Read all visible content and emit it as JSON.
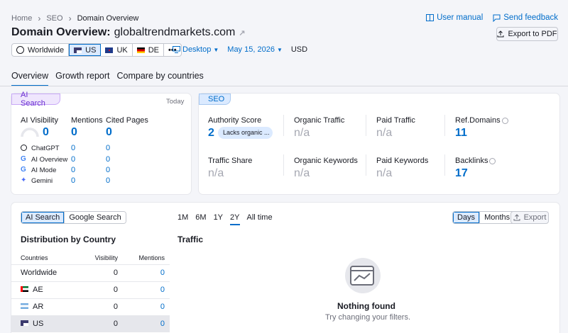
{
  "breadcrumb": [
    "Home",
    "SEO",
    "Domain Overview"
  ],
  "top_links": {
    "manual": "User manual",
    "feedback": "Send feedback"
  },
  "title": {
    "prefix": "Domain Overview:",
    "domain": "globaltrendmarkets.com"
  },
  "export_pdf": "Export to PDF",
  "databases": [
    "Worldwide",
    "US",
    "UK",
    "DE",
    "•••"
  ],
  "filters": {
    "device": "Desktop",
    "date": "May 15, 2026",
    "currency": "USD"
  },
  "tabs": [
    "Overview",
    "Growth report",
    "Compare by countries"
  ],
  "ai_card": {
    "label": "AI Search",
    "today": "Today",
    "headers": [
      "AI Visibility",
      "Mentions",
      "Cited Pages"
    ],
    "visibility": "0",
    "mentions": "0",
    "cited": "0",
    "rows": [
      {
        "name": "ChatGPT",
        "m": "0",
        "c": "0"
      },
      {
        "name": "AI Overview",
        "m": "0",
        "c": "0"
      },
      {
        "name": "AI Mode",
        "m": "0",
        "c": "0"
      },
      {
        "name": "Gemini",
        "m": "0",
        "c": "0"
      }
    ]
  },
  "seo_card": {
    "label": "SEO",
    "authority_label": "Authority Score",
    "authority_value": "2",
    "authority_badge": "Lacks organic ...",
    "organic_traffic": "Organic Traffic",
    "paid_traffic": "Paid Traffic",
    "ref_domains": "Ref.Domains",
    "ref_domains_value": "11",
    "traffic_share": "Traffic Share",
    "organic_keywords": "Organic Keywords",
    "paid_keywords": "Paid Keywords",
    "backlinks": "Backlinks",
    "backlinks_value": "17",
    "na": "n/a"
  },
  "bottom": {
    "toggle": [
      "AI Search",
      "Google Search"
    ],
    "periods": [
      "1M",
      "6M",
      "1Y",
      "2Y",
      "All time"
    ],
    "range": [
      "Days",
      "Months"
    ],
    "export": "Export",
    "dist_title": "Distribution by Country",
    "traffic_title": "Traffic",
    "table_headers": [
      "Countries",
      "Visibility",
      "Mentions"
    ],
    "rows": [
      {
        "country": "Worldwide",
        "visibility": "0",
        "mentions": "0"
      },
      {
        "country": "AE",
        "visibility": "0",
        "mentions": "0"
      },
      {
        "country": "AR",
        "visibility": "0",
        "mentions": "0"
      },
      {
        "country": "US",
        "visibility": "0",
        "mentions": "0"
      }
    ],
    "nothing_found": "Nothing found",
    "nothing_hint": "Try changing your filters."
  },
  "colors": {
    "accent": "#006dca",
    "ai_pill": "#efe6fd",
    "seo_pill": "#dbeaff"
  }
}
